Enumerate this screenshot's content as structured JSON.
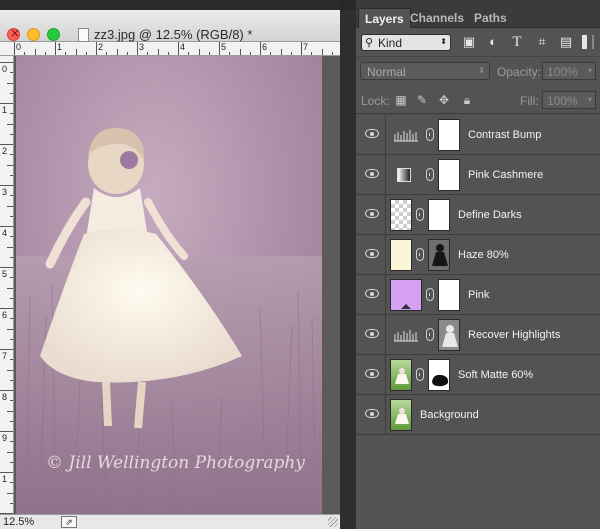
{
  "document": {
    "title": "zz3.jpg @ 12.5% (RGB/8) *",
    "zoom": "12.5%",
    "ruler_top": [
      "0",
      "1",
      "2",
      "3",
      "4",
      "5",
      "6",
      "7"
    ],
    "ruler_left": [
      "0",
      "1",
      "2",
      "3",
      "4",
      "5",
      "6",
      "7",
      "8",
      "9",
      "1",
      "1"
    ],
    "watermark": "© Jill Wellington Photography"
  },
  "panel": {
    "tabs": [
      {
        "label": "Layers",
        "active": true
      },
      {
        "label": "Channels",
        "active": false
      },
      {
        "label": "Paths",
        "active": false
      }
    ],
    "filter_kind": "Kind",
    "blend_mode": "Normal",
    "opacity_label": "Opacity:",
    "opacity_value": "100%",
    "lock_label": "Lock:",
    "fill_label": "Fill:",
    "fill_value": "100%",
    "layers": [
      {
        "name": "Contrast Bump",
        "type": "curves-adjustment",
        "mask": "white"
      },
      {
        "name": "Pink Cashmere",
        "type": "gradient-map-adjustment",
        "mask": "white"
      },
      {
        "name": "Define Darks",
        "type": "transparent-pixel",
        "mask": "white"
      },
      {
        "name": "Haze 80%",
        "type": "solid-fill",
        "fill_color": "#fbf6d7",
        "mask": "figure"
      },
      {
        "name": "Pink",
        "type": "solid-fill",
        "fill_color": "#d6a0f2",
        "mask": "white"
      },
      {
        "name": "Recover Highlights",
        "type": "curves-adjustment",
        "mask": "figure"
      },
      {
        "name": "Soft Matte 60%",
        "type": "photo",
        "mask": "blob"
      },
      {
        "name": "Background",
        "type": "photo",
        "mask": "none"
      }
    ]
  }
}
